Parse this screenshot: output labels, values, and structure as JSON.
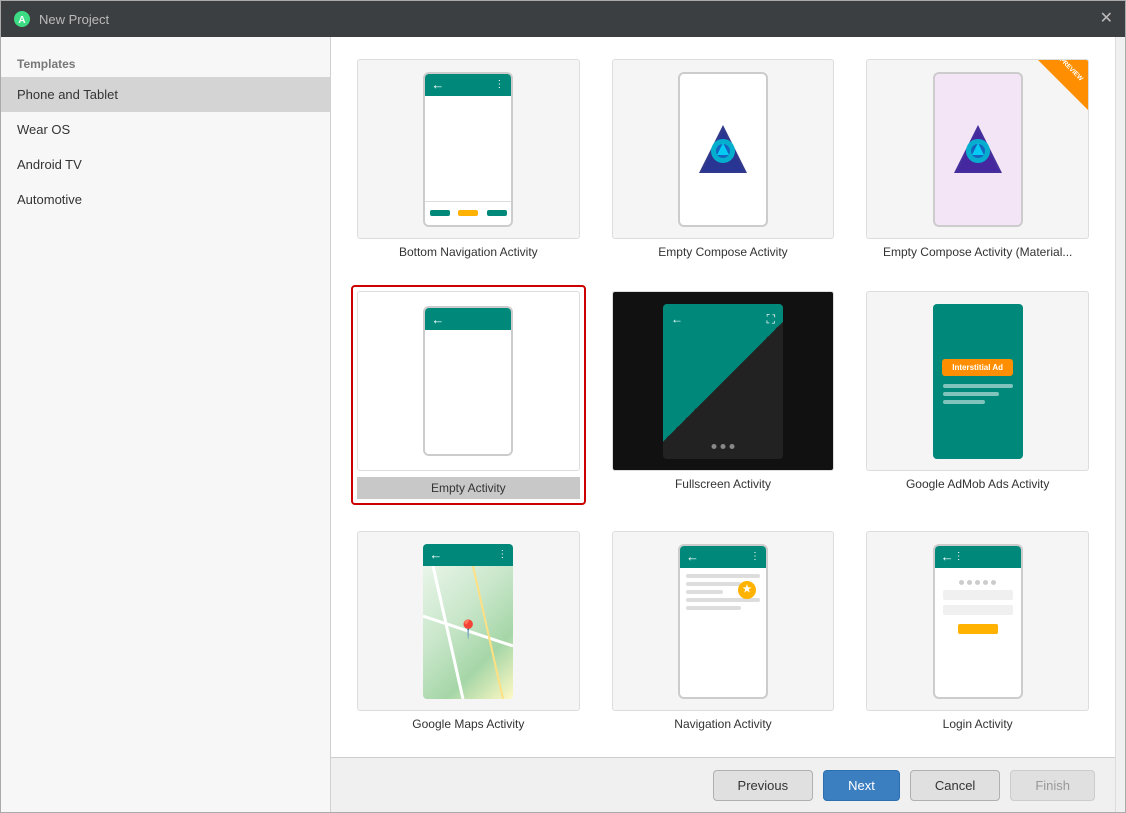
{
  "window": {
    "title": "New Project",
    "close_label": "✕"
  },
  "sidebar": {
    "section_label": "Templates",
    "items": [
      {
        "id": "phone-tablet",
        "label": "Phone and Tablet",
        "active": true
      },
      {
        "id": "wear-os",
        "label": "Wear OS",
        "active": false
      },
      {
        "id": "android-tv",
        "label": "Android TV",
        "active": false
      },
      {
        "id": "automotive",
        "label": "Automotive",
        "active": false
      }
    ]
  },
  "templates": [
    {
      "id": "bottom-nav",
      "label": "Bottom Navigation Activity",
      "selected": false
    },
    {
      "id": "empty-compose",
      "label": "Empty Compose Activity",
      "selected": false
    },
    {
      "id": "empty-compose-material",
      "label": "Empty Compose Activity (Material...",
      "selected": false
    },
    {
      "id": "empty-activity",
      "label": "Empty Activity",
      "selected": true
    },
    {
      "id": "fullscreen",
      "label": "Fullscreen Activity",
      "selected": false
    },
    {
      "id": "admob",
      "label": "Google AdMob Ads Activity",
      "selected": false
    },
    {
      "id": "maps",
      "label": "Google Maps Activity",
      "selected": false
    },
    {
      "id": "notifications",
      "label": "Navigation Activity",
      "selected": false
    },
    {
      "id": "login",
      "label": "Login Activity",
      "selected": false
    }
  ],
  "footer": {
    "previous_label": "Previous",
    "next_label": "Next",
    "cancel_label": "Cancel",
    "finish_label": "Finish"
  }
}
